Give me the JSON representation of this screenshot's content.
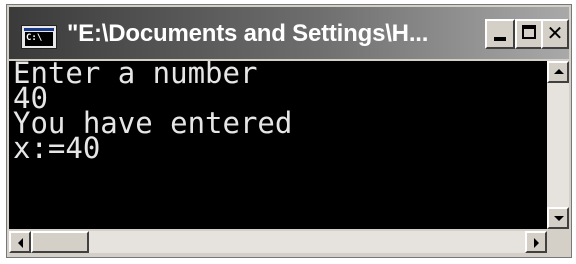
{
  "window": {
    "title": "\"E:\\Documents and Settings\\H..."
  },
  "console": {
    "lines": [
      "Enter a number",
      "40",
      "You have entered",
      "x:=40"
    ]
  },
  "icons": {
    "app": "console-app-icon",
    "minimize": "minimize-icon",
    "maximize": "maximize-icon",
    "close": "close-icon",
    "app_glyph": "C:\\"
  },
  "colors": {
    "console_bg": "#000000",
    "console_text": "#e6e6e6",
    "titlebar_start": "#3a3a3a",
    "titlebar_end": "#a9a9a9"
  }
}
